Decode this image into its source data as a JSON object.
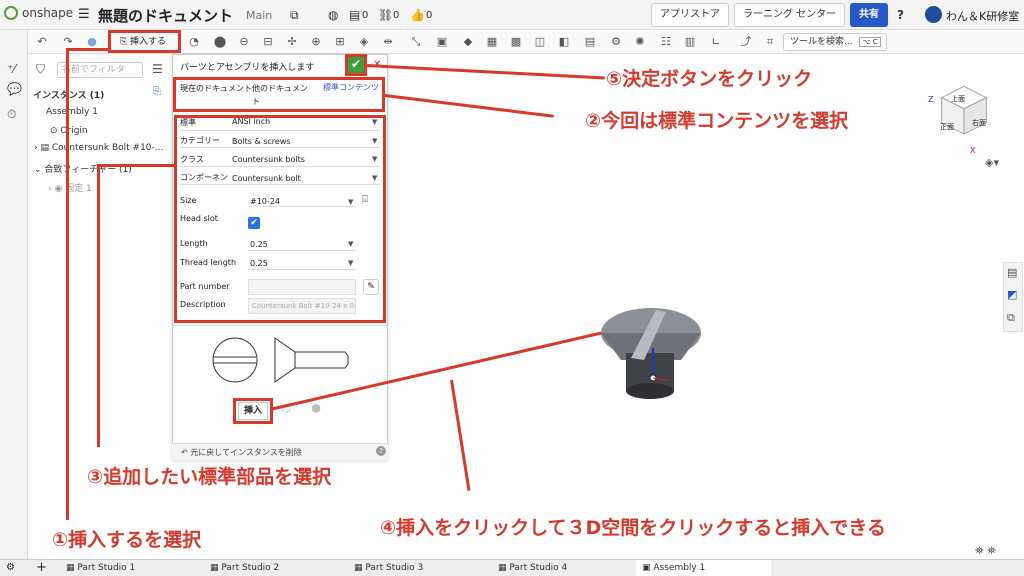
{
  "topbar": {
    "logo_text": "onshape",
    "doc_title": "無題のドキュメント",
    "workspace": "Main",
    "counts": {
      "versions": "0",
      "links": "0",
      "likes": "0"
    },
    "app_store": "アプリストア",
    "learning_center": "ラーニング センター",
    "share": "共有",
    "help": "?",
    "user": "わん＆K研修室"
  },
  "toolbar": {
    "insert": "挿入する",
    "tool_search": "ツールを検索...",
    "shortcut": "⌥ C"
  },
  "leftpanel": {
    "filter_placeholder": "名前でフィルタ",
    "instances": "インスタンス (1)",
    "assembly": "Assembly 1",
    "origin": "Origin",
    "bolt": "Countersunk Bolt #10-...",
    "mate_features": "合致フィーチャー (1)",
    "fixed": "固定 1"
  },
  "dialog": {
    "title": "パーツとアセンブリを挿入します",
    "tabs": [
      "現在のドキュメント",
      "他のドキュメント",
      "標準コンテンツ"
    ],
    "fields": [
      {
        "label": "標準",
        "value": "ANSI inch"
      },
      {
        "label": "カテゴリー",
        "value": "Bolts & screws"
      },
      {
        "label": "クラス",
        "value": "Countersunk bolts"
      },
      {
        "label": "コンポーネント",
        "value": "Countersunk bolt"
      }
    ],
    "size_label": "Size",
    "size_value": "#10-24",
    "head_slot_label": "Head slot",
    "length_label": "Length",
    "length_value": "0.25",
    "thread_label": "Thread length",
    "thread_value": "0.25",
    "part_number_label": "Part number",
    "description_label": "Description",
    "description_placeholder": "Countersunk Bolt #10-24 x 0.",
    "insert_button": "挿入",
    "footer": "元に戻してインスタンスを削除"
  },
  "viewcube": {
    "top": "上面",
    "front": "正面",
    "right": "右面",
    "z": "Z",
    "x": "X"
  },
  "callouts": {
    "c1": "①挿入するを選択",
    "c2": "②今回は標準コンテンツを選択",
    "c3": "③追加したい標準部品を選択",
    "c4": "④挿入をクリックして３D空間をクリックすると挿入できる",
    "c5": "⑤決定ボタンをクリック"
  },
  "tabs": [
    "Part Studio 1",
    "Part Studio 2",
    "Part Studio 3",
    "Part Studio 4",
    "Assembly 1"
  ],
  "colors": {
    "accent": "#2659c7",
    "callout": "#d9382a",
    "ok": "#3e9e3a"
  }
}
